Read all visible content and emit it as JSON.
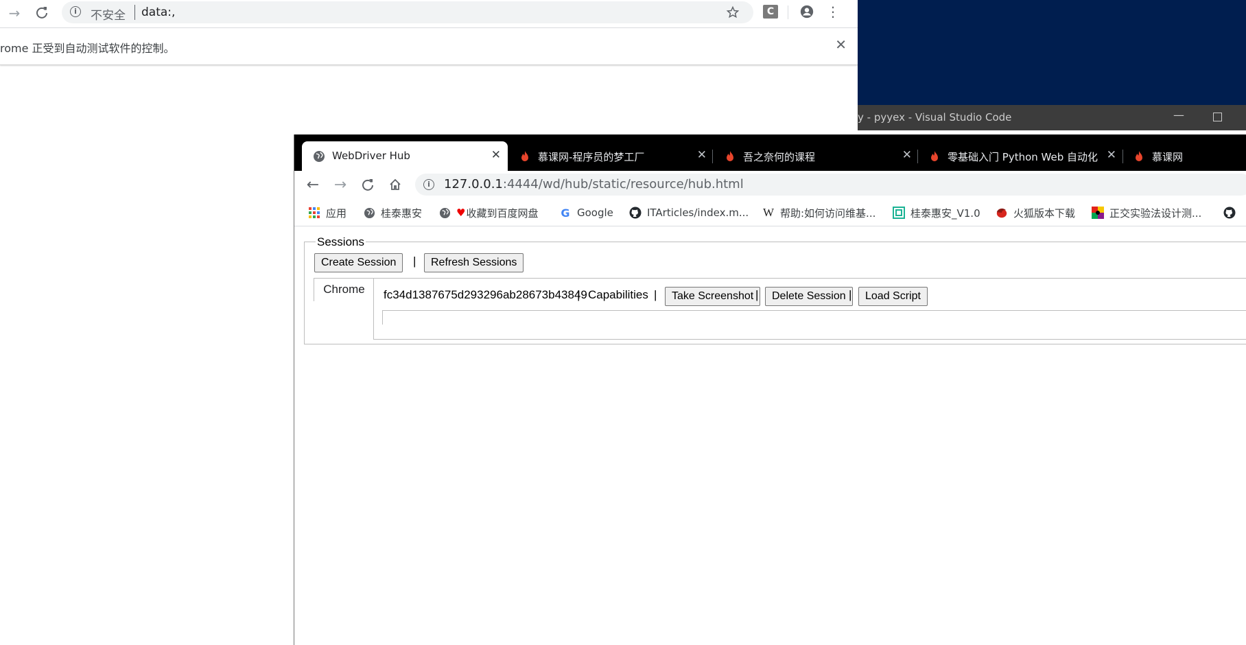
{
  "back_window": {
    "insecure_label": "不安全",
    "url": "data:,",
    "infobar_text": "rome 正受到自动测试软件的控制。",
    "infobar_close": "✕"
  },
  "vscode": {
    "title": "y - pyyex - Visual Studio Code"
  },
  "tabs": [
    {
      "title": "WebDriver Hub",
      "active": true
    },
    {
      "title": "慕课网-程序员的梦工厂",
      "active": false
    },
    {
      "title": "吾之奈何的课程",
      "active": false
    },
    {
      "title": "零基础入门 Python Web 自动化",
      "active": false
    },
    {
      "title": "慕课网",
      "active": false
    }
  ],
  "tab_close": "✕",
  "address": {
    "host": "127.0.0.1",
    "rest": ":4444/wd/hub/static/resource/hub.html"
  },
  "bookmarks": [
    {
      "label": "应用",
      "icon": "apps-grid-icon"
    },
    {
      "label": "桂泰惠安",
      "icon": "globe-icon"
    },
    {
      "label": "收藏到百度网盘",
      "icon": "globe-icon"
    },
    {
      "label": "Google",
      "icon": "google-icon"
    },
    {
      "label": "ITArticles/index.m...",
      "icon": "github-icon"
    },
    {
      "label": "帮助:如何访问维基...",
      "icon": "wikipedia-icon"
    },
    {
      "label": "桂泰惠安_V1.0",
      "icon": "green-square-icon"
    },
    {
      "label": "火狐版本下载",
      "icon": "firefox-icon"
    },
    {
      "label": "正交实验法设计测...",
      "icon": "colorful-square-icon"
    }
  ],
  "hub": {
    "legend": "Sessions",
    "create_session": "Create Session",
    "refresh_sessions": "Refresh Sessions",
    "separator": "|",
    "session_tab": "Chrome",
    "session_id": "fc34d1387675d293296ab28673b43849",
    "capabilities": "Capabilities",
    "take_screenshot": "Take Screenshot",
    "delete_session": "Delete Session",
    "load_script": "Load Script"
  },
  "colors": {
    "vscode_bg": "#001e4f",
    "tabstrip_bg": "#000000",
    "flame": "#e8452c"
  }
}
